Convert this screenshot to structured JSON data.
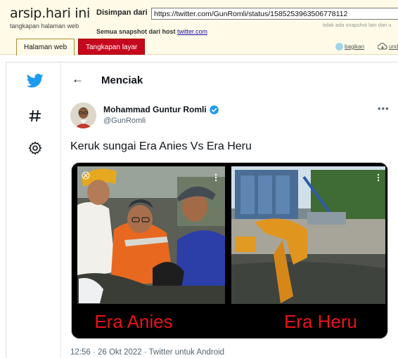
{
  "archive": {
    "logo": "arsip.hari ini",
    "tagline": "tangkapan halaman web",
    "saved_from_label": "Disimpan dari",
    "url": "https://twitter.com/GunRomli/status/1585253963506778112",
    "no_other_snapshot": "tidak ada snapshot lain dari u",
    "all_snapshots_label": "Semua snapshot  dari host",
    "host_link": "twitter.com",
    "tabs": [
      "Halaman web",
      "Tangkapan layar"
    ],
    "share_label": "bagikan",
    "download_label": "und"
  },
  "twitter": {
    "header_title": "Menciak",
    "back_icon": "←",
    "author": {
      "name": "Mohammad Guntur Romli",
      "handle": "@GunRomli",
      "verified": true
    },
    "more_icon": "•••",
    "text": "Keruk sungai Era Anies Vs Era Heru",
    "image_captions": [
      "Era Anies",
      "Era Heru"
    ],
    "caption_color": "#e8121c",
    "meta": "12:56 · 26 Okt 2022 · Twitter untuk Android",
    "brand_color": "#1d9bf0"
  }
}
